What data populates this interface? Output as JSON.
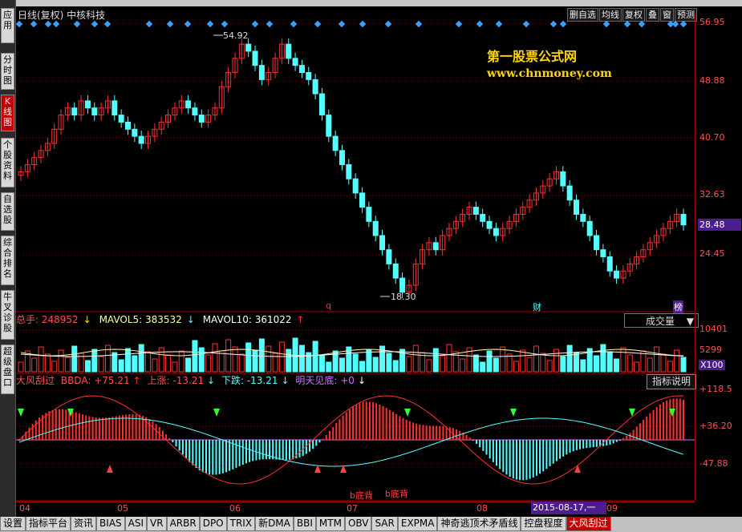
{
  "window": {
    "chart_title": "日线(复权)  中核科技",
    "top_buttons": [
      "删自选",
      "均线",
      "复权",
      "叠",
      "窗",
      "预测"
    ]
  },
  "sidebar": {
    "items": [
      {
        "label": "应用",
        "active": false
      },
      {
        "label": "分时图",
        "active": false
      },
      {
        "label": "K线图",
        "active": true
      },
      {
        "label": "个股资料",
        "active": false
      },
      {
        "label": "自选股",
        "active": false
      },
      {
        "label": "综合排名",
        "active": false
      },
      {
        "label": "牛叉诊股",
        "active": false
      },
      {
        "label": "超级盘口",
        "active": false
      }
    ]
  },
  "watermark": {
    "line1": "第一股票公式网",
    "line2": "www.chnmoney.com"
  },
  "price_panel": {
    "axis_labels": [
      "56.95",
      "48.88",
      "40.70",
      "32.63",
      "24.45"
    ],
    "current_price": "28.48",
    "high_label": "54.92",
    "low_label": "18.30",
    "markers": {
      "q": "q",
      "cai": "财",
      "bang": "榜"
    }
  },
  "volume_panel": {
    "total": "总手: 248952",
    "mavol5": "MAVOL5: 383532",
    "mavol10": "MAVOL10: 361022",
    "selector_label": "成交量",
    "axis_labels": [
      "10401",
      "5299"
    ],
    "unit": "X100"
  },
  "indicator_panel": {
    "name": "大风刮过",
    "bbda": "BBDA: +75.21",
    "up": "上涨: -13.21",
    "down": "下跌: -13.21",
    "tomorrow": "明天见底: +0",
    "explain_button": "指标说明",
    "axis_labels": [
      "+118.5",
      "+36.20",
      "-47.88"
    ],
    "annotations": [
      "b底背",
      "b底背"
    ]
  },
  "date_axis": {
    "labels": [
      "04",
      "05",
      "06",
      "07",
      "08",
      "09"
    ],
    "selected_date": "2015-08-17,一"
  },
  "tabs": [
    {
      "label": "设置",
      "active": false
    },
    {
      "label": "指标平台",
      "active": false
    },
    {
      "label": "资讯",
      "active": false
    },
    {
      "label": "BIAS",
      "active": false
    },
    {
      "label": "ASI",
      "active": false
    },
    {
      "label": "VR",
      "active": false
    },
    {
      "label": "ARBR",
      "active": false
    },
    {
      "label": "DPO",
      "active": false
    },
    {
      "label": "TRIX",
      "active": false
    },
    {
      "label": "新DMA",
      "active": false
    },
    {
      "label": "BBI",
      "active": false
    },
    {
      "label": "MTM",
      "active": false
    },
    {
      "label": "OBV",
      "active": false
    },
    {
      "label": "SAR",
      "active": false
    },
    {
      "label": "EXPMA",
      "active": false
    },
    {
      "label": "神奇逃顶术矛盾线",
      "active": false
    },
    {
      "label": "控盘程度",
      "active": false
    },
    {
      "label": "大风刮过",
      "active": true
    }
  ],
  "colors": {
    "up": "#ff3030",
    "down": "#54ffff",
    "grid": "#880000",
    "mavol5": "#ffffa0",
    "mavol10": "#ffffff",
    "accent_purple": "#4b1d8f"
  }
}
